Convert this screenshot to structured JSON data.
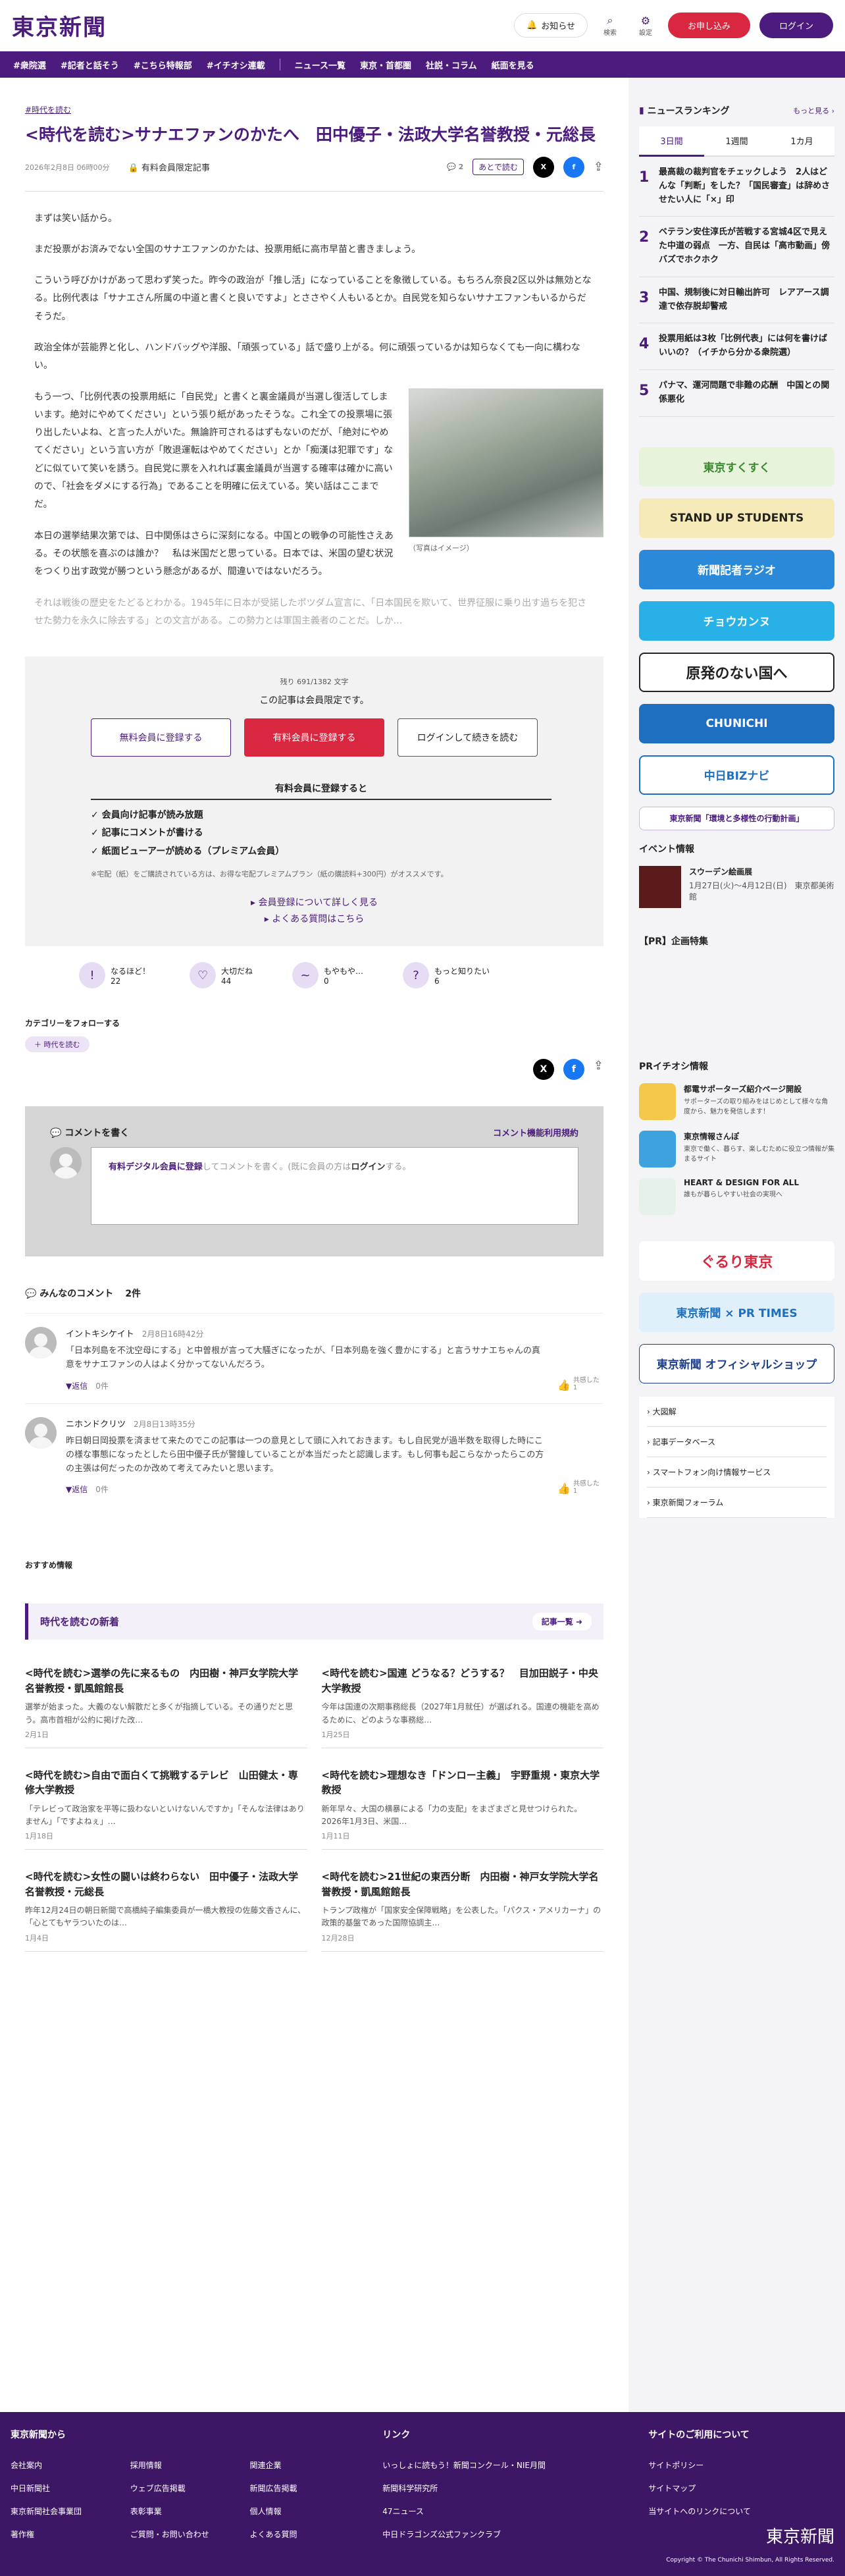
{
  "header": {
    "logo": "東京新聞",
    "notice": "お知らせ",
    "search": "検索",
    "settings": "設定",
    "register": "お申し込み",
    "login": "ログイン"
  },
  "nav": [
    "#衆院選",
    "#記者と話そう",
    "#こちら特報部",
    "#イチオシ連載",
    "ニュース一覧",
    "東京・首都圏",
    "社説・コラム",
    "紙面を見る"
  ],
  "article": {
    "tag": "#時代を読む",
    "title": "<時代を読む>サナエファンのかたへ　田中優子・法政大学名誉教授・元総長",
    "date": "2026年2月8日 06時00分",
    "lock": "有料会員限定記事",
    "comment_count": "2",
    "later": "あとで読む",
    "paragraphs": [
      "まずは笑い話から。",
      "まだ投票がお済みでない全国のサナエファンのかたは、投票用紙に高市早苗と書きましょう。",
      "こういう呼びかけがあって思わず笑った。昨今の政治が「推し活」になっていることを象徴している。もちろん奈良2区以外は無効となる。比例代表は「サナエさん所属の中道と書くと良いですよ」とささやく人もいるとか。自民党を知らないサナエファンもいるからだそうだ。",
      "政治全体が芸能界と化し、ハンドバッグや洋服、「頑張っている」話で盛り上がる。何に頑張っているかは知らなくても一向に構わない。",
      "もう一つ、「比例代表の投票用紙に「自民党」と書くと裏金議員が当選し復活してしまいます。絶対にやめてください」という張り紙があったそうな。これ全ての投票場に張り出したいよね、と言った人がいた。無論許可されるはずもないのだが、「絶対にやめてください」という言い方が「敗退運転はやめてください」とか「痴漢は犯罪です」などに似ていて笑いを誘う。自民党に票を入れれば裏金議員が当選する確率は確かに高いので、「社会をダメにする行為」であることを明確に伝えている。笑い話はここまでだ。",
      "本日の選挙結果次第では、日中関係はさらに深刻になる。中国との戦争の可能性さえある。その状態を喜ぶのは誰か？　私は米国だと思っている。日本では、米国の望む状況をつくり出す政党が勝つという懸念があるが、間違いではないだろう。",
      "それは戦後の歴史をたどるとわかる。1945年に日本が受諾したポツダム宣言に、「日本国民を欺いて、世界征服に乗り出す過ちを犯させた勢力を永久に除去する」との文言がある。この勢力とは軍国主義者のことだ。しか…"
    ],
    "photo_caption": "（写真はイメージ）"
  },
  "paywall": {
    "remaining": "残り 691/1382 文字",
    "limited": "この記事は会員限定です。",
    "free": "無料会員に登録する",
    "paid": "有料会員に登録する",
    "login": "ログインして続きを読む",
    "benefit_title": "有料会員に登録すると",
    "benefits": [
      "✓ 会員向け記事が読み放題",
      "✓ 記事にコメントが書ける",
      "✓ 紙面ビューアーが読める（プレミアム会員）"
    ],
    "note": "※宅配（紙）をご購読されている方は、お得な宅配プレミアムプラン（紙の購読料+300円）がオススメです。",
    "link1": "▸ 会員登録について詳しく見る",
    "link2": "▸ よくある質問はこちら"
  },
  "reactions": [
    {
      "label": "なるほど！",
      "count": "22",
      "face": "!"
    },
    {
      "label": "大切だね",
      "count": "44",
      "face": "♡"
    },
    {
      "label": "もやもや…",
      "count": "0",
      "face": "~"
    },
    {
      "label": "もっと知りたい",
      "count": "6",
      "face": "?"
    }
  ],
  "category": {
    "title": "カテゴリーをフォローする",
    "chip": "＋ 時代を読む"
  },
  "comment_form": {
    "title": "コメントを書く",
    "rule": "コメント機能利用規約",
    "pre": "有料デジタル会員に登録",
    "mid": "してコメントを書く。(既に会員の方は",
    "login": "ログイン",
    "post": "する。"
  },
  "comments": {
    "title": "みんなのコメント",
    "count": "2件",
    "items": [
      {
        "name": "イントキシケイト",
        "date": "2月8日16時42分",
        "text": "「日本列島を不沈空母にする」と中曽根が言って大騒ぎになったが、「日本列島を強く豊かにする」と言うサナエちゃんの真意をサナエファンの人はよく分かってないんだろう。",
        "reply": "▼返信",
        "rcount": "0件",
        "agree": "共感した 1"
      },
      {
        "name": "ニホンドクリツ",
        "date": "2月8日13時35分",
        "text": "昨日朝日岡投票を済ませて来たのでこの記事は一つの意見として頭に入れておきます。もし自民党が過半数を取得した時にこの様な事態になったとしたら田中優子氏が警鐘していることが本当だったと認識します。もし何事も起こらなかったらこの方の主張は何だったのか改めて考えてみたいと思います。",
        "reply": "▼返信",
        "rcount": "0件",
        "agree": "共感した 1"
      }
    ]
  },
  "recommend": {
    "label": "おすすめ情報",
    "head": "時代を読むの新着",
    "more": "記事一覧 ➜",
    "cards": [
      {
        "t": "<時代を読む>選挙の先に来るもの　内田樹・神戸女学院大学名誉教授・凱風館館長",
        "s": "選挙が始まった。大義のない解散だと多くが指摘している。その通りだと思う。高市首相が公約に掲げた改…",
        "d": "2月1日"
      },
      {
        "t": "<時代を読む>国連 どうなる？どうする？　目加田説子・中央大学教授",
        "s": "今年は国連の次期事務総長（2027年1月就任）が選ばれる。国連の機能を高めるために、どのような事務総…",
        "d": "1月25日"
      },
      {
        "t": "<時代を読む>自由で面白くて挑戦するテレビ　山田健太・専修大学教授",
        "s": "「テレビって政治家を平等に扱わないといけないんですか」「そんな法律はありません」「ですよねぇ」…",
        "d": "1月18日"
      },
      {
        "t": "<時代を読む>理想なき「ドンロー主義」　宇野重規・東京大学教授",
        "s": "新年早々、大国の横暴による「力の支配」をまざまざと見せつけられた。　2026年1月3日、米国…",
        "d": "1月11日"
      },
      {
        "t": "<時代を読む>女性の闘いは終わらない　田中優子・法政大学名誉教授・元総長",
        "s": "昨年12月24日の朝日新聞で高橋純子編集委員が一橋大教授の佐藤文香さんに、「心とてもヤラついたのは…",
        "d": "1月4日"
      },
      {
        "t": "<時代を読む>21世紀の東西分断　内田樹・神戸女学院大学名誉教授・凱風館館長",
        "s": "トランプ政権が「国家安全保障戦略」を公表した。「パクス・アメリカーナ」の政策的基盤であった国際協調主…",
        "d": "12月28日"
      }
    ]
  },
  "sidebar": {
    "ranking_title": "ニュースランキング",
    "more": "もっと見る ›",
    "tabs": [
      "3日間",
      "1週間",
      "1カ月"
    ],
    "ranks": [
      {
        "n": "1",
        "t": "最高裁の裁判官をチェックしよう　2人はどんな「判断」をした？「国民審査」は辞めさせたい人に「×」印"
      },
      {
        "n": "2",
        "t": "ベテラン安住淳氏が苦戦する宮城4区で見えた中道の弱点　一方、自民は「高市動画」傍バズでホクホク"
      },
      {
        "n": "3",
        "t": "中国、規制後に対日輸出許可　レアアース調達で依存脱却警戒"
      },
      {
        "n": "4",
        "t": "投票用紙は3枚「比例代表」には何を書けばいいの？（イチから分かる衆院選）"
      },
      {
        "n": "5",
        "t": "パナマ、運河問題で非難の応酬　中国との関係悪化"
      }
    ],
    "banners": [
      "東京すくすく",
      "STAND UP STUDENTS",
      "新聞記者ラジオ",
      "チョウカンヌ",
      "原発のない国へ",
      "CHUNICHI",
      "中日BIZナビ",
      "東京新聞「環境と多様性の行動計画」"
    ],
    "event_title": "イベント情報",
    "event": {
      "t": "スウーデン絵画展",
      "s": "1月27日(火)〜4月12日(日)　東京都美術館"
    },
    "pr_title": "【PR】企画特集",
    "pr2_title": "PRイチオシ情報",
    "prs": [
      {
        "t": "都電サポーターズ紹介ページ開設",
        "s": "サポーターズの取り組みをはじめとして様々な角度から、魅力を発信します！"
      },
      {
        "t": "東京情報さんぽ",
        "s": "東京で働く、暮らす、楽しむために役立つ情報が集まるサイト"
      },
      {
        "t": "HEART & DESIGN FOR ALL",
        "s": "誰もが暮らしやすい社会の実現へ"
      }
    ],
    "banners2": [
      "ぐるり東京",
      "東京新聞 × PR TIMES",
      "東京新聞 オフィシャルショップ"
    ],
    "links": [
      "› 大図解",
      "› 記事データベース",
      "› スマートフォン向け情報サービス",
      "› 東京新聞フォーラム"
    ]
  },
  "footer": {
    "c1": "東京新聞から",
    "c1items": [
      "会社案内",
      "採用情報",
      "関連企業",
      "中日新聞社",
      "ウェブ広告掲載",
      "新聞広告掲載",
      "東京新聞社会事業団",
      "表彰事業",
      "個人情報",
      "著作権",
      "ご質問・お問い合わせ",
      "よくある質問"
    ],
    "c2": "リンク",
    "c2items": [
      "いっしょに読もう！新聞コンクール・NIE月間",
      "新聞科学研究所",
      "47ニュース",
      "中日ドラゴンズ公式ファンクラブ"
    ],
    "c3": "サイトのご利用について",
    "c3items": [
      "サイトポリシー",
      "サイトマップ",
      "当サイトへのリンクについて"
    ],
    "logo": "東京新聞",
    "copy": "Copyright © The Chunichi Shimbun, All Rights Reserved."
  }
}
